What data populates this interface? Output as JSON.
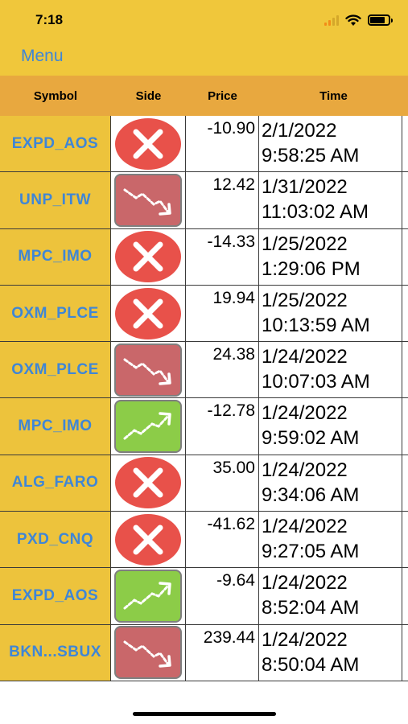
{
  "status_bar": {
    "time": "7:18",
    "icons": [
      "cellular-signal-icon",
      "wifi-icon",
      "battery-icon"
    ]
  },
  "nav": {
    "menu_label": "Menu"
  },
  "table": {
    "headers": {
      "symbol": "Symbol",
      "side": "Side",
      "price": "Price",
      "time": "Time"
    },
    "rows": [
      {
        "symbol": "EXPD_AOS",
        "side_icon": "close-x-icon",
        "price": "-10.90",
        "date": "2/1/2022",
        "time": "9:58:25 AM"
      },
      {
        "symbol": "UNP_ITW",
        "side_icon": "trend-down-icon",
        "price": "12.42",
        "date": "1/31/2022",
        "time": "11:03:02 AM"
      },
      {
        "symbol": "MPC_IMO",
        "side_icon": "close-x-icon",
        "price": "-14.33",
        "date": "1/25/2022",
        "time": "1:29:06 PM"
      },
      {
        "symbol": "OXM_PLCE",
        "side_icon": "close-x-icon",
        "price": "19.94",
        "date": "1/25/2022",
        "time": "10:13:59 AM"
      },
      {
        "symbol": "OXM_PLCE",
        "side_icon": "trend-down-icon",
        "price": "24.38",
        "date": "1/24/2022",
        "time": "10:07:03 AM"
      },
      {
        "symbol": "MPC_IMO",
        "side_icon": "trend-up-icon",
        "price": "-12.78",
        "date": "1/24/2022",
        "time": "9:59:02 AM"
      },
      {
        "symbol": "ALG_FARO",
        "side_icon": "close-x-icon",
        "price": "35.00",
        "date": "1/24/2022",
        "time": "9:34:06 AM"
      },
      {
        "symbol": "PXD_CNQ",
        "side_icon": "close-x-icon",
        "price": "-41.62",
        "date": "1/24/2022",
        "time": "9:27:05 AM"
      },
      {
        "symbol": "EXPD_AOS",
        "side_icon": "trend-up-icon",
        "price": "-9.64",
        "date": "1/24/2022",
        "time": "8:52:04 AM"
      },
      {
        "symbol": "BKN...SBUX",
        "side_icon": "trend-down-icon",
        "price": "239.44",
        "date": "1/24/2022",
        "time": "8:50:04 AM"
      }
    ]
  },
  "colors": {
    "header_yellow": "#f0c73b",
    "column_header_orange": "#e8a83f",
    "symbol_cell_yellow": "#edc33c",
    "link_blue": "#3f86d6",
    "close_red": "#e8514a",
    "down_red": "#c9676a",
    "up_green": "#8ccc48"
  }
}
